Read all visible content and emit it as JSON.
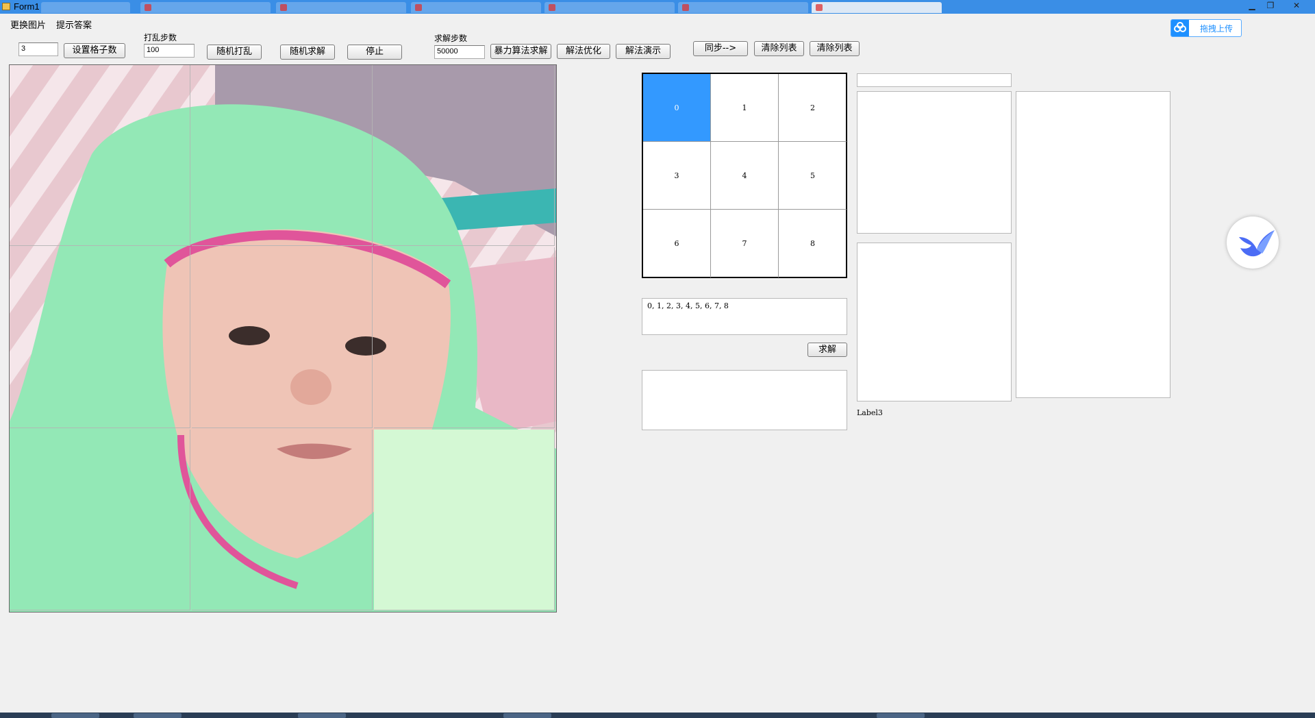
{
  "window": {
    "title": "Form1"
  },
  "menu": {
    "change_image": "更换图片",
    "hint_answer": "提示答案"
  },
  "controls": {
    "grid_size_value": "3",
    "set_grid_button": "设置格子数",
    "shuffle_steps_label": "打乱步数",
    "shuffle_steps_value": "100",
    "random_shuffle_button": "随机打乱",
    "random_solve_button": "随机求解",
    "stop_button": "停止",
    "solve_steps_label": "求解步数",
    "solve_steps_value": "50000",
    "brute_force_button": "暴力算法求解",
    "optimize_button": "解法优化",
    "demo_button": "解法演示",
    "sync_button": "同步-->",
    "clear_list_button_1": "清除列表",
    "clear_list_button_2": "清除列表"
  },
  "grid": {
    "selected_index": 0,
    "cells": [
      "0",
      "1",
      "2",
      "3",
      "4",
      "5",
      "6",
      "7",
      "8"
    ]
  },
  "sequence_text": "0, 1, 2, 3, 4, 5, 6, 7, 8",
  "solve_button": "求解",
  "label3": "Label3",
  "upload_badge": "拖拽上传",
  "colors": {
    "selection": "#3399ff",
    "empty_tile": "#d4f8d4",
    "upload_accent": "#1e90ff"
  }
}
